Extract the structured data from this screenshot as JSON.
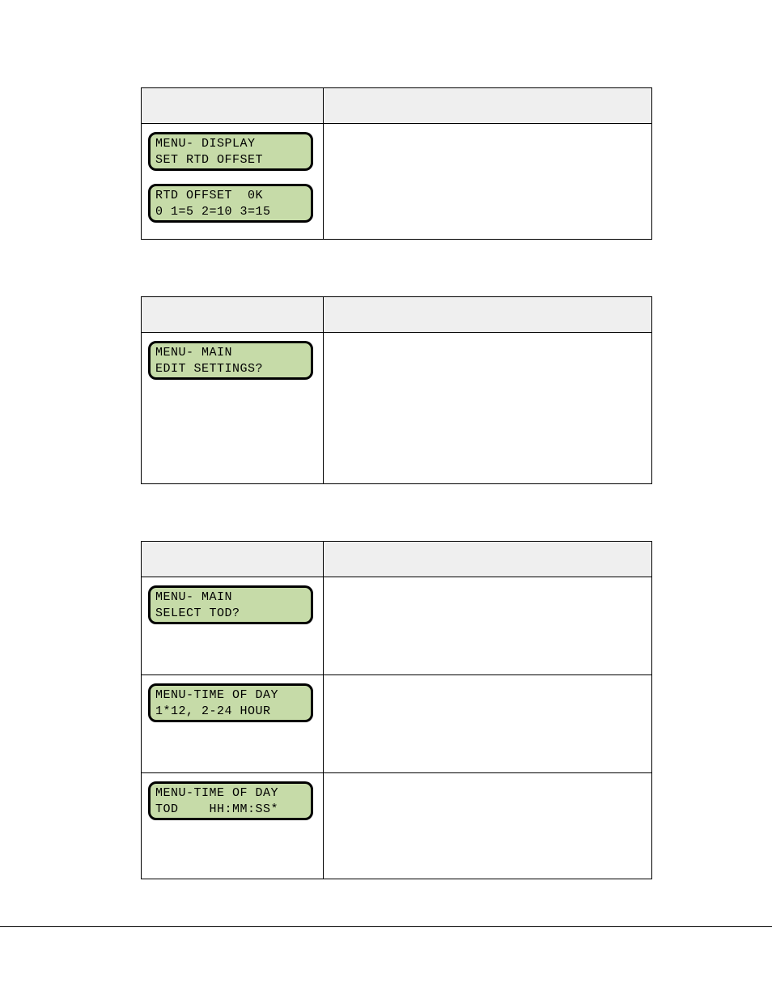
{
  "panel1": {
    "lcd1": {
      "line1": "MENU- DISPLAY",
      "line2": "SET RTD OFFSET"
    },
    "lcd2": {
      "line1": "RTD OFFSET  0K",
      "line2": "0 1=5 2=10 3=15"
    }
  },
  "panel2": {
    "lcd1": {
      "line1": "MENU- MAIN",
      "line2": "EDIT SETTINGS?"
    }
  },
  "panel3": {
    "row1": {
      "lcd": {
        "line1": "MENU- MAIN",
        "line2": "SELECT TOD?"
      }
    },
    "row2": {
      "lcd": {
        "line1": "MENU-TIME OF DAY",
        "line2": "1*12, 2-24 HOUR"
      }
    },
    "row3": {
      "lcd": {
        "line1": "MENU-TIME OF DAY",
        "line2": "TOD    HH:MM:SS*"
      }
    }
  }
}
